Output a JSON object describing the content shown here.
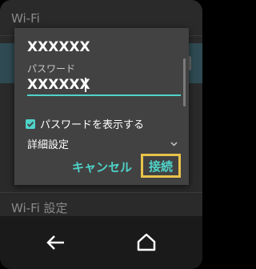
{
  "background": {
    "title": "Wi-Fi",
    "settings_label": "Wi-Fi 設定"
  },
  "dialog": {
    "ssid": "XXXXXX",
    "password_label": "パスワード",
    "password_value": "XXXXXX",
    "show_password_label": "パスワードを表示する",
    "show_password_checked": true,
    "advanced_label": "詳細設定",
    "cancel_label": "キャンセル",
    "connect_label": "接続"
  },
  "colors": {
    "accent": "#4fd3c9",
    "highlight_frame": "#e8c34a",
    "dialog_bg": "#424242"
  },
  "navbar": {
    "back_icon": "arrow-left-icon",
    "home_icon": "home-icon"
  }
}
